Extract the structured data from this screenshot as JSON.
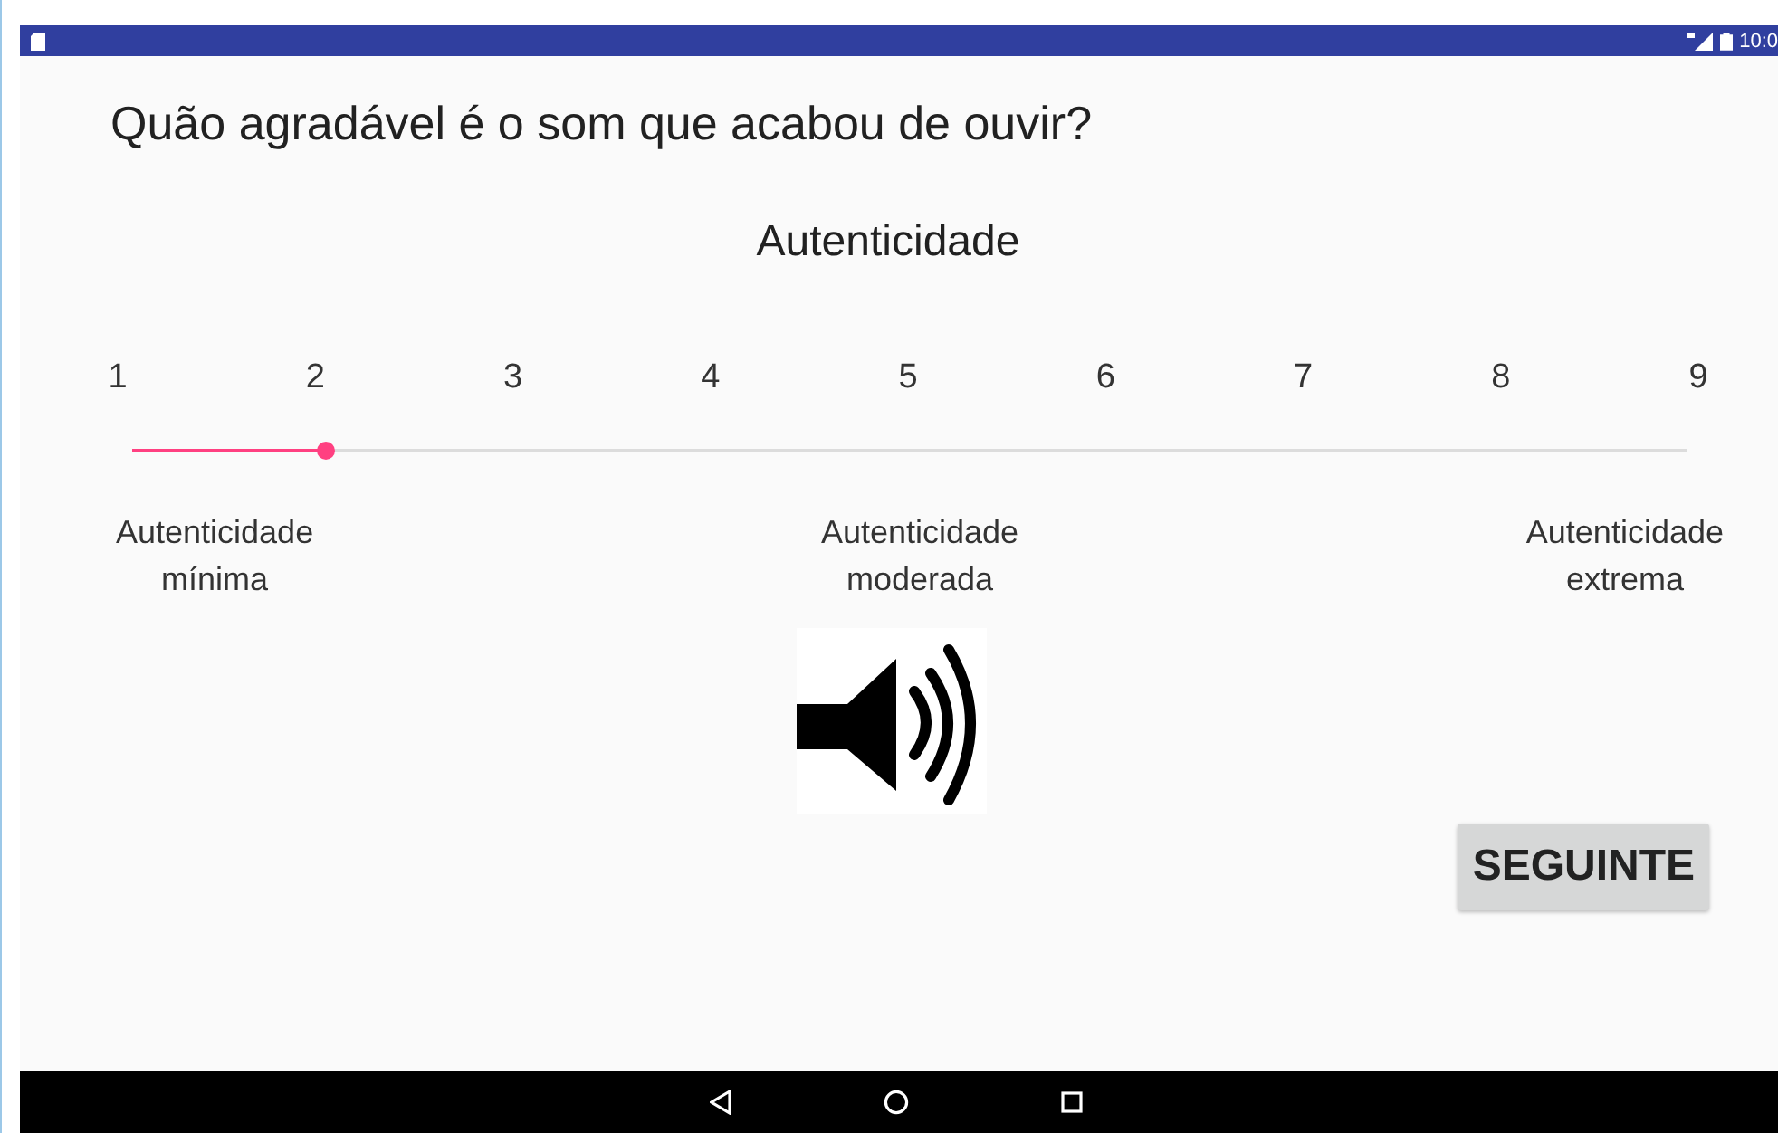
{
  "status_bar": {
    "time": "10:0"
  },
  "question": "Quão agradável é o som que acabou de ouvir?",
  "scale": {
    "title": "Autenticidade",
    "ticks": [
      "1",
      "2",
      "3",
      "4",
      "5",
      "6",
      "7",
      "8",
      "9"
    ],
    "level": 0.125,
    "anchors": [
      {
        "line1": "Autenticidade",
        "line2": "mínima"
      },
      {
        "line1": "Autenticidade",
        "line2": "moderada"
      },
      {
        "line1": "Autenticidade",
        "line2": "extrema"
      }
    ]
  },
  "next_button": "SEGUINTE",
  "nav_bar": [
    {
      "kind": "back"
    },
    {
      "kind": "home"
    },
    {
      "kind": "recents"
    }
  ]
}
